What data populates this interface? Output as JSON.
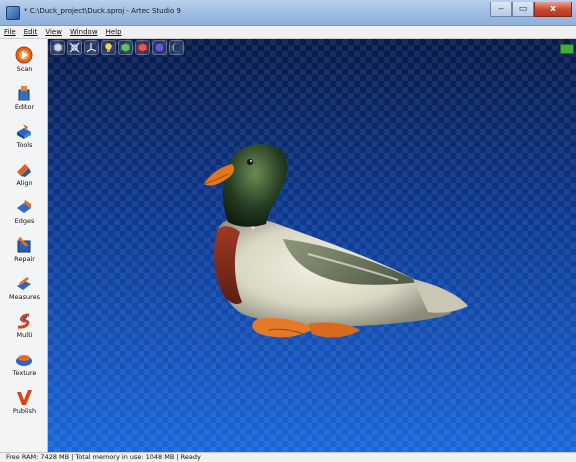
{
  "window": {
    "title": "* C:\\Duck_project\\Duck.sproj - Artec Studio 9",
    "minimize_label": "‒",
    "maximize_label": "▭",
    "close_label": "x"
  },
  "menu": {
    "items": [
      {
        "label": "File"
      },
      {
        "label": "Edit"
      },
      {
        "label": "View"
      },
      {
        "label": "Window"
      },
      {
        "label": "Help"
      }
    ]
  },
  "sidebar": {
    "items": [
      {
        "label": "Scan",
        "icon": "scan-icon"
      },
      {
        "label": "Editor",
        "icon": "editor-icon"
      },
      {
        "label": "Tools",
        "icon": "tools-icon"
      },
      {
        "label": "Align",
        "icon": "align-icon"
      },
      {
        "label": "Edges",
        "icon": "edges-icon"
      },
      {
        "label": "Repair",
        "icon": "repair-icon"
      },
      {
        "label": "Measures",
        "icon": "measures-icon"
      },
      {
        "label": "Multi",
        "icon": "multi-icon"
      },
      {
        "label": "Texture",
        "icon": "texture-icon"
      },
      {
        "label": "Publish",
        "icon": "publish-icon"
      }
    ]
  },
  "viewport_toolbar": {
    "icons": [
      "perspective-cube-icon",
      "fit-view-icon",
      "axes-icon",
      "light-bulb-icon",
      "solid-render-icon",
      "texture-render-icon",
      "sphere-render-icon",
      "moon-mode-icon"
    ]
  },
  "status": {
    "text": "Free RAM: 7428 MB  |  Total memory in use: 1048 MB  |  Ready"
  },
  "colors": {
    "viewport_top": "#071a4a",
    "viewport_bottom": "#1a66d8",
    "scan_accent": "#e8641e"
  }
}
